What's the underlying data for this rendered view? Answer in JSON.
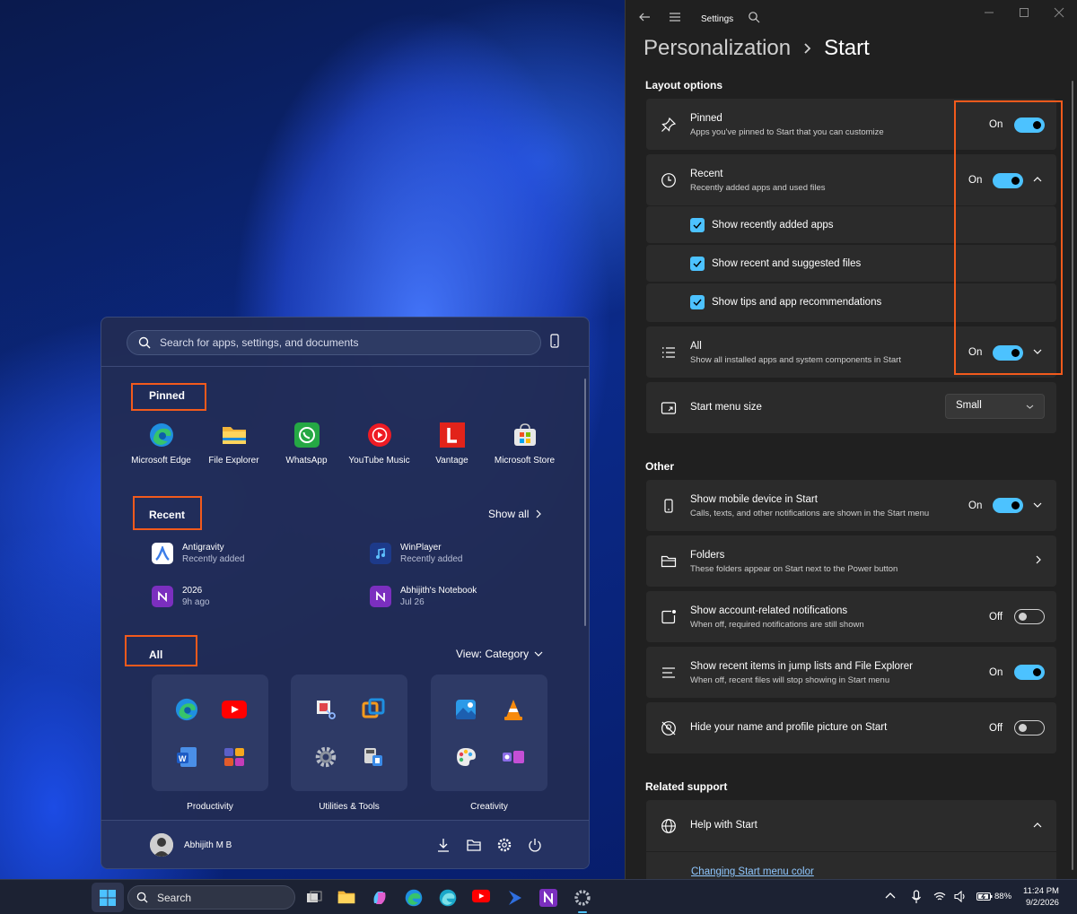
{
  "start_menu": {
    "search_placeholder": "Search for apps, settings, and documents",
    "pinned_label": "Pinned",
    "pinned": [
      {
        "label": "Microsoft Edge",
        "icon": "edge-icon"
      },
      {
        "label": "File Explorer",
        "icon": "folder-icon"
      },
      {
        "label": "WhatsApp",
        "icon": "whatsapp-icon"
      },
      {
        "label": "YouTube Music",
        "icon": "youtube-music-icon"
      },
      {
        "label": "Vantage",
        "icon": "vantage-icon"
      },
      {
        "label": "Microsoft Store",
        "icon": "store-icon"
      }
    ],
    "recent_label": "Recent",
    "show_all": "Show all",
    "recent": [
      {
        "name": "Antigravity",
        "sub": "Recently added",
        "icon": "antigravity-icon"
      },
      {
        "name": "WinPlayer",
        "sub": "Recently added",
        "icon": "winplayer-icon"
      },
      {
        "name": "2026",
        "sub": "9h ago",
        "icon": "onenote-icon"
      },
      {
        "name": "Abhijith's Notebook",
        "sub": "Jul 26",
        "icon": "onenote-icon"
      }
    ],
    "all_label": "All",
    "view_label": "View: Category",
    "categories": [
      {
        "label": "Productivity",
        "icons": [
          "edge-icon",
          "youtube-icon",
          "word-icon",
          "teams-office-icon"
        ]
      },
      {
        "label": "Utilities & Tools",
        "icons": [
          "snipping-tool-icon",
          "remote-desktop-icon",
          "settings-icon",
          "calculator-icon"
        ]
      },
      {
        "label": "Creativity",
        "icons": [
          "photos-icon",
          "vlc-icon",
          "paint-icon",
          "clipchamp-icon"
        ]
      }
    ],
    "user_name": "Abhijith M B"
  },
  "settings": {
    "app_title": "Settings",
    "breadcrumb_parent": "Personalization",
    "breadcrumb_current": "Start",
    "layout_header": "Layout options",
    "pinned_title": "Pinned",
    "pinned_sub": "Apps you've pinned to Start that you can customize",
    "pinned_state": "On",
    "recent_title": "Recent",
    "recent_sub": "Recently added apps and used files",
    "recent_state": "On",
    "checks": [
      "Show recently added apps",
      "Show recent and suggested files",
      "Show tips and app recommendations"
    ],
    "all_title": "All",
    "all_sub": "Show all installed apps and system components in Start",
    "all_state": "On",
    "size_title": "Start menu size",
    "size_value": "Small",
    "other_header": "Other",
    "mobile_title": "Show mobile device in Start",
    "mobile_sub": "Calls, texts, and other notifications are shown in the Start menu",
    "mobile_state": "On",
    "folders_title": "Folders",
    "folders_sub": "These folders appear on Start next to the Power button",
    "account_title": "Show account-related notifications",
    "account_sub": "When off, required notifications are still shown",
    "account_state": "Off",
    "jump_title": "Show recent items in jump lists and File Explorer",
    "jump_sub": "When off, recent files will stop showing in Start menu",
    "jump_state": "On",
    "hide_title": "Hide your name and profile picture on Start",
    "hide_state": "Off",
    "support_header": "Related support",
    "help_title": "Help with Start",
    "help_link": "Changing Start menu color"
  },
  "taskbar": {
    "search": "Search",
    "battery": "88%",
    "time": "11:24 PM",
    "date": "9/2/2026"
  },
  "colors": {
    "accent": "#4cc2ff",
    "highlight": "#f25a1c"
  }
}
